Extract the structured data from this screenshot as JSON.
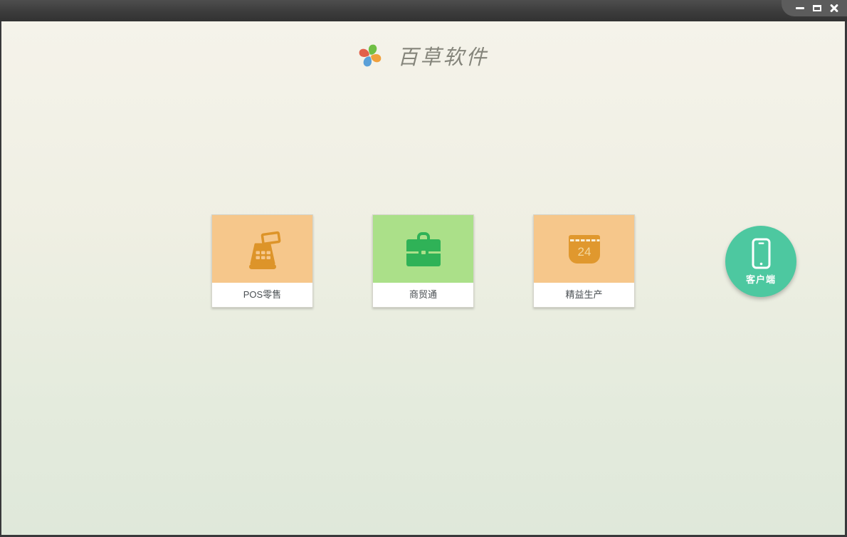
{
  "window": {
    "titlebar": {
      "draggable": true
    },
    "controls": {
      "minimize": "minimize",
      "maximize": "maximize",
      "close": "close"
    }
  },
  "header": {
    "app_name": "百草软件",
    "logo": "pinwheel-icon",
    "logo_colors": {
      "top": "#6fbf44",
      "right": "#f0a03c",
      "bottom": "#5aa0d8",
      "left": "#e2604a"
    }
  },
  "products": [
    {
      "label": "POS零售",
      "icon": "cash-register-icon",
      "tile_color": "#f6c78b",
      "icon_color": "#dd9429"
    },
    {
      "label": "商贸通",
      "icon": "briefcase-icon",
      "tile_color": "#abe089",
      "icon_color": "#2fb257"
    },
    {
      "label": "精益生产",
      "icon": "calendar-icon",
      "tile_color": "#f6c78b",
      "icon_color": "#e0982e",
      "calendar_day": "24"
    }
  ],
  "client": {
    "label": "客户端",
    "icon": "smartphone-icon",
    "color": "#4dc8a0"
  },
  "colors": {
    "titlebar_top": "#4e4e4e",
    "titlebar_bottom": "#323232",
    "controls_panel": "#5c5c5c",
    "frame_border": "#38383a",
    "content_top": "#f5f3ea",
    "content_bottom": "#dfe8da",
    "card_label_text": "#4a4f53",
    "app_title_text": "#85857b"
  }
}
